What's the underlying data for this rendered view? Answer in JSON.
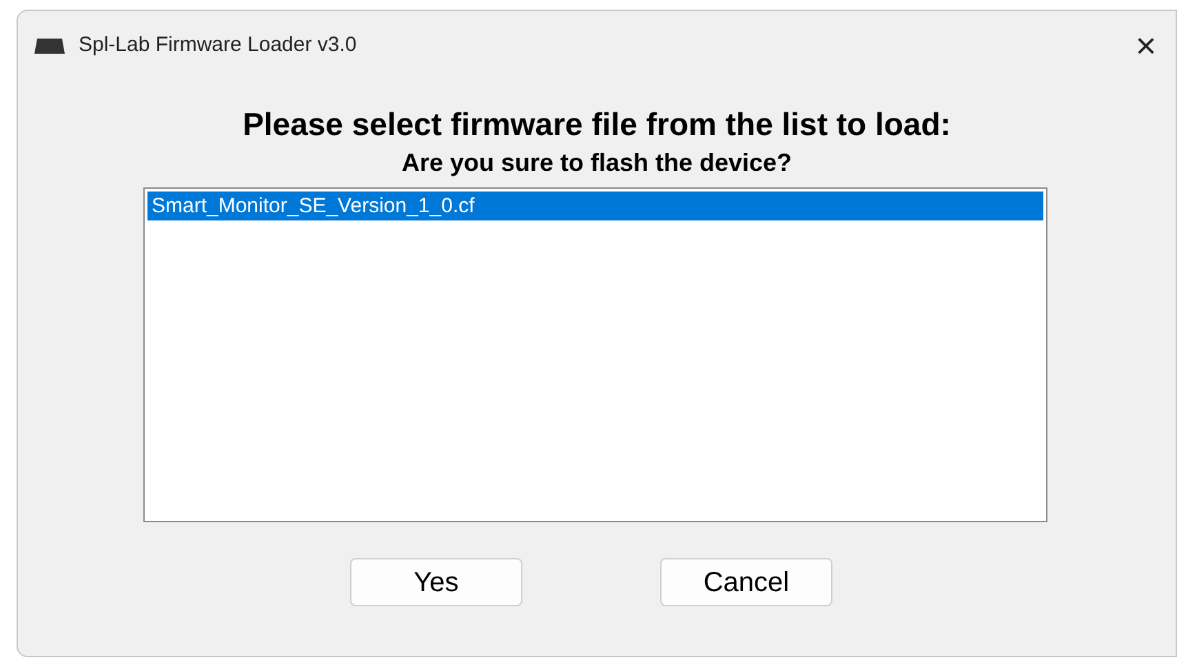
{
  "window": {
    "title": "Spl-Lab Firmware Loader v3.0",
    "close": "×"
  },
  "heading": "Please select firmware file from the list to load:",
  "subheading": "Are you sure to flash the device?",
  "files": [
    {
      "name": "Smart_Monitor_SE_Version_1_0.cf",
      "selected": true
    }
  ],
  "buttons": [
    {
      "label": "Yes"
    },
    {
      "label": "Cancel"
    }
  ]
}
